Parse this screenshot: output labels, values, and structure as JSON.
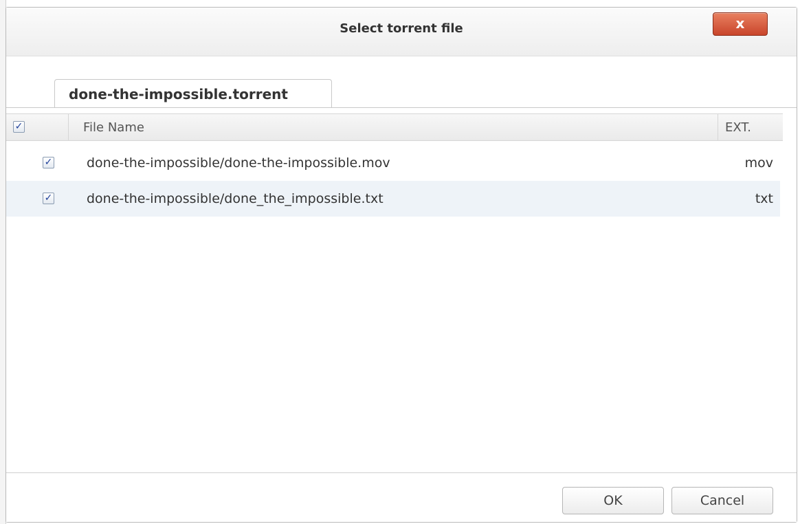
{
  "dialog": {
    "title": "Select torrent file",
    "close_label": "x"
  },
  "tab": {
    "label": "done-the-impossible.torrent"
  },
  "table": {
    "columns": {
      "select_all_checked": true,
      "file_name": "File Name",
      "ext": "EXT."
    },
    "rows": [
      {
        "checked": true,
        "file_name": "done-the-impossible/done-the-impossible.mov",
        "ext": "mov"
      },
      {
        "checked": true,
        "file_name": "done-the-impossible/done_the_impossible.txt",
        "ext": "txt"
      }
    ]
  },
  "footer": {
    "ok_label": "OK",
    "cancel_label": "Cancel"
  },
  "colors": {
    "close_button": "#c9452b",
    "row_alt": "#eef3f8",
    "checkmark": "#1f3f99"
  },
  "icons": {
    "close": "close-icon",
    "checkbox": "checkbox-checked-icon"
  }
}
